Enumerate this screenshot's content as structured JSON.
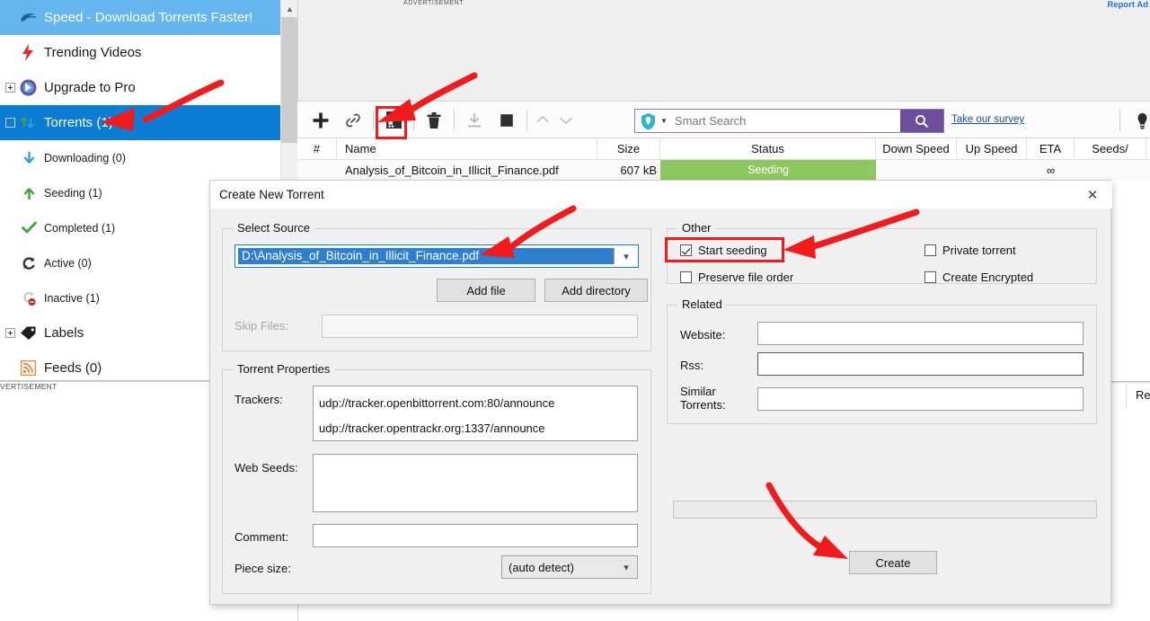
{
  "sidebar": {
    "items": [
      {
        "label": "Speed - Download Torrents Faster!",
        "icon": "speed-icon",
        "state": "highlight"
      },
      {
        "label": "Trending Videos",
        "icon": "lightning-icon",
        "state": "normal"
      },
      {
        "label": "Upgrade to Pro",
        "icon": "bittorrent-logo-icon",
        "state": "normal"
      },
      {
        "label": "Torrents (1)",
        "icon": "transfer-arrows-icon",
        "state": "selected"
      },
      {
        "label": "Downloading (0)",
        "icon": "down-arrow-icon",
        "state": "child"
      },
      {
        "label": "Seeding (1)",
        "icon": "up-arrow-icon",
        "state": "child"
      },
      {
        "label": "Completed (1)",
        "icon": "checkmark-icon",
        "state": "child"
      },
      {
        "label": "Active (0)",
        "icon": "refresh-icon",
        "state": "child"
      },
      {
        "label": "Inactive (1)",
        "icon": "inactive-icon",
        "state": "child"
      },
      {
        "label": "Labels",
        "icon": "tag-icon",
        "state": "normal"
      },
      {
        "label": "Feeds (0)",
        "icon": "rss-icon",
        "state": "normal"
      }
    ],
    "ad_label": "VERTISEMENT"
  },
  "ad_banner": {
    "label": "ADVERTISEMENT",
    "report_link": "Report Ad"
  },
  "toolbar": {
    "buttons": [
      {
        "name": "add-torrent",
        "icon": "plus-icon"
      },
      {
        "name": "add-torrent-from-url",
        "icon": "link-icon"
      },
      {
        "name": "create-new-torrent",
        "icon": "create-torrent-icon"
      },
      {
        "name": "remove-torrent",
        "icon": "trash-icon"
      },
      {
        "name": "start-torrent",
        "icon": "download-icon"
      },
      {
        "name": "stop-torrent",
        "icon": "stop-square-icon"
      },
      {
        "name": "move-up",
        "icon": "chevron-up-icon"
      },
      {
        "name": "move-down",
        "icon": "chevron-down-icon"
      }
    ],
    "search_placeholder": "Smart Search",
    "search_value": "",
    "survey_link": "Take our survey"
  },
  "torrent_list": {
    "columns": [
      "#",
      "Name",
      "Size",
      "Status",
      "Down Speed",
      "Up Speed",
      "ETA",
      "Seeds/"
    ],
    "rows": [
      {
        "index": "",
        "name": "Analysis_of_Bitcoin_in_Illicit_Finance.pdf",
        "size": "607 kB",
        "status": "Seeding",
        "down_speed": "",
        "up_speed": "",
        "eta": "∞",
        "seeds": ""
      }
    ],
    "status_color": "#8dc760",
    "detail_tab_label": "Res"
  },
  "dialog": {
    "title": "Create New Torrent",
    "close_label": "✕",
    "select_source": {
      "group_label": "Select Source",
      "path_value": "D:\\Analysis_of_Bitcoin_in_Illicit_Finance.pdf",
      "add_file_label": "Add file",
      "add_directory_label": "Add directory",
      "skip_files_label": "Skip Files:",
      "skip_files_value": ""
    },
    "torrent_properties": {
      "group_label": "Torrent Properties",
      "trackers_label": "Trackers:",
      "trackers_value": [
        "udp://tracker.openbittorrent.com:80/announce",
        "udp://tracker.opentrackr.org:1337/announce"
      ],
      "web_seeds_label": "Web Seeds:",
      "web_seeds_value": "",
      "comment_label": "Comment:",
      "comment_value": "",
      "piece_size_label": "Piece size:",
      "piece_size_value": "(auto detect)"
    },
    "other": {
      "group_label": "Other",
      "checkboxes": [
        {
          "label": "Start seeding",
          "checked": true
        },
        {
          "label": "Preserve file order",
          "checked": false
        },
        {
          "label": "Private torrent",
          "checked": false
        },
        {
          "label": "Create Encrypted",
          "checked": false
        }
      ]
    },
    "related": {
      "group_label": "Related",
      "website_label": "Website:",
      "website_value": "",
      "rss_label": "Rss:",
      "rss_value": "",
      "similar_label_line1": "Similar",
      "similar_label_line2": "Torrents:",
      "similar_value": ""
    },
    "create_button_label": "Create",
    "progress_value": ""
  },
  "annotations": {
    "color": "#f21a1a",
    "highlight_boxes": [
      "create-new-torrent-toolbar-button",
      "start-seeding-checkbox"
    ],
    "arrows": [
      "arrow-to-torrents-sidebar",
      "arrow-to-create-torrent-button",
      "arrow-to-source-path",
      "arrow-to-start-seeding",
      "arrow-to-create-button"
    ]
  }
}
